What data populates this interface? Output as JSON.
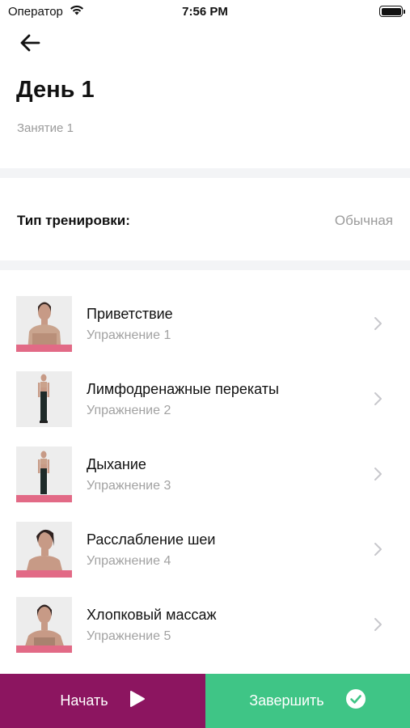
{
  "status_bar": {
    "carrier": "Оператор",
    "time": "7:56 PM"
  },
  "header": {
    "title": "День 1",
    "subtitle": "Занятие 1"
  },
  "workout_type": {
    "label": "Тип тренировки:",
    "value": "Обычная"
  },
  "exercises": [
    {
      "title": "Приветствие",
      "subtitle": "Упражнение 1"
    },
    {
      "title": "Лимфодренажные перекаты",
      "subtitle": "Упражнение 2"
    },
    {
      "title": "Дыхание",
      "subtitle": "Упражнение 3"
    },
    {
      "title": "Расслабление шеи",
      "subtitle": "Упражнение 4"
    },
    {
      "title": "Хлопковый массаж",
      "subtitle": "Упражнение 5"
    }
  ],
  "actions": {
    "start_label": "Начать",
    "finish_label": "Завершить"
  },
  "colors": {
    "start_button": "#8c1560",
    "finish_button": "#3fc586",
    "thumbnail_strip": "#e26a86"
  },
  "icons": {
    "back": "arrow-left-icon",
    "wifi": "wifi-icon",
    "battery": "battery-icon",
    "chevron": "chevron-right-icon",
    "play": "play-icon",
    "check": "check-circle-icon"
  }
}
